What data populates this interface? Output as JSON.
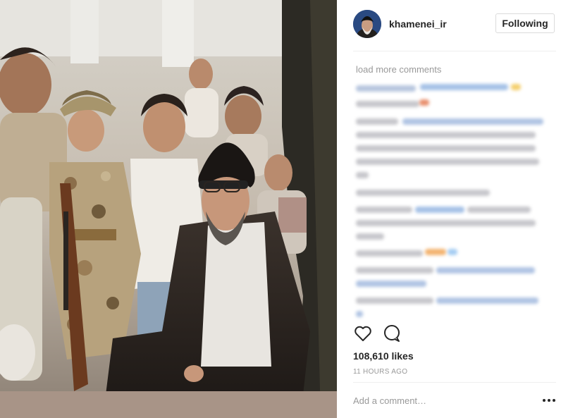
{
  "post": {
    "username": "khamenei_ir",
    "follow_label": "Following",
    "load_more": "load more comments",
    "likes": "108,610 likes",
    "time": "11 HOURS AGO",
    "add_comment_placeholder": "Add a comment…"
  },
  "icons": {
    "like": "heart-icon",
    "comment": "comment-bubble-icon",
    "more": "more-options-icon",
    "avatar": "profile-avatar"
  }
}
